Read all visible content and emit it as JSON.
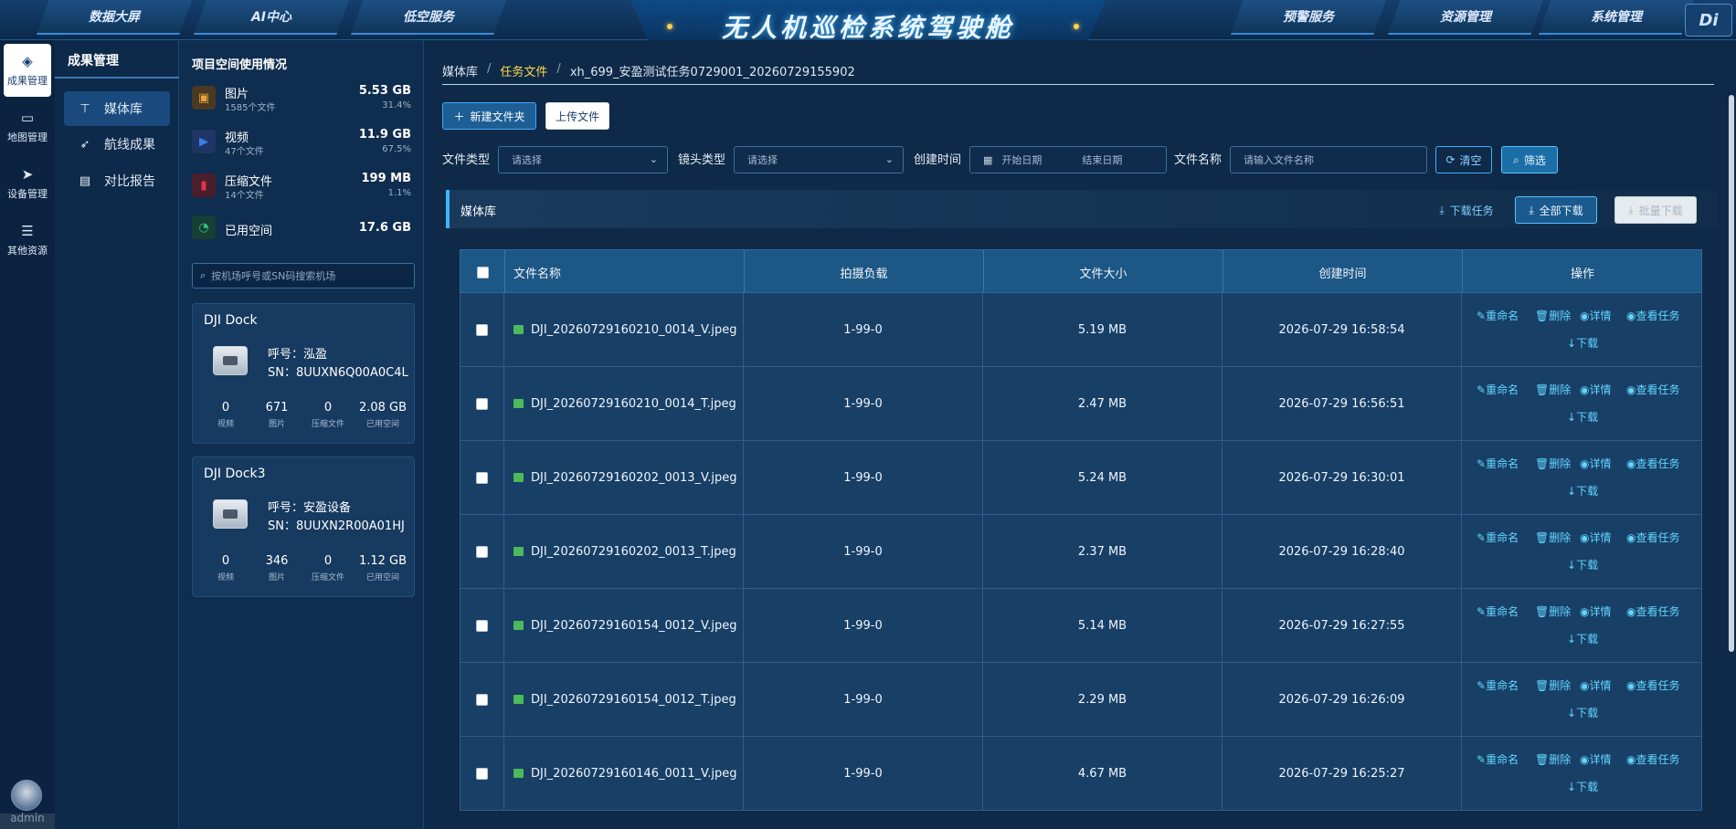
{
  "nav": {
    "left_tabs": [
      "数据大屏",
      "AI中心",
      "低空服务"
    ],
    "title": "无人机巡检系统驾驶舱",
    "right_tabs": [
      "预警服务",
      "资源管理",
      "系统管理"
    ],
    "logo": "Di"
  },
  "rail": {
    "items": [
      {
        "label": "成果管理",
        "icon": "layers-icon"
      },
      {
        "label": "地图管理",
        "icon": "monitor-icon"
      },
      {
        "label": "设备管理",
        "icon": "plane-icon"
      },
      {
        "label": "其他资源",
        "icon": "list-icon"
      }
    ],
    "user": "admin",
    "status_url": "https://172.88.3.108/home/result/media"
  },
  "submenu": {
    "title": "成果管理",
    "items": [
      {
        "label": "媒体库",
        "icon": "tree-icon"
      },
      {
        "label": "航线成果",
        "icon": "send-icon"
      },
      {
        "label": "对比报告",
        "icon": "doc-icon"
      }
    ]
  },
  "storage": {
    "title": "项目空间使用情况",
    "rows": [
      {
        "name": "图片",
        "sub": "1585个文件",
        "size": "5.53 GB",
        "pct": "31.4%",
        "icon": "image-icon",
        "color": "#e8a33b"
      },
      {
        "name": "视频",
        "sub": "47个文件",
        "size": "11.9 GB",
        "pct": "67.5%",
        "icon": "video-icon",
        "color": "#3b7be8"
      },
      {
        "name": "压缩文件",
        "sub": "14个文件",
        "size": "199 MB",
        "pct": "1.1%",
        "icon": "zip-icon",
        "color": "#e0344a"
      },
      {
        "name": "已用空间",
        "sub": "",
        "size": "17.6 GB",
        "pct": "",
        "icon": "pie-icon",
        "color": "#2ec27e"
      }
    ],
    "search_placeholder": "按机场呼号或SN码搜索机场"
  },
  "docks": [
    {
      "name": "DJI Dock",
      "call": "呼号：泓盈",
      "sn": "SN：8UUXN6Q00A0C4L",
      "stats": [
        {
          "v": "0",
          "l": "视频"
        },
        {
          "v": "671",
          "l": "图片"
        },
        {
          "v": "0",
          "l": "压缩文件"
        },
        {
          "v": "2.08 GB",
          "l": "已用空间"
        }
      ]
    },
    {
      "name": "DJI Dock3",
      "call": "呼号：安盈设备",
      "sn": "SN：8UUXN2R00A01HJ",
      "stats": [
        {
          "v": "0",
          "l": "视频"
        },
        {
          "v": "346",
          "l": "图片"
        },
        {
          "v": "0",
          "l": "压缩文件"
        },
        {
          "v": "1.12 GB",
          "l": "已用空间"
        }
      ]
    }
  ],
  "main": {
    "breadcrumb": [
      "媒体库",
      "任务文件",
      "xh_699_安盈测试任务0729001_20260729155902"
    ],
    "buttons": {
      "new_folder": "新建文件夹",
      "upload": "上传文件",
      "clear": "清空",
      "filter": "筛选"
    },
    "filters": {
      "file_type_label": "文件类型",
      "file_type_placeholder": "请选择",
      "lens_type_label": "镜头类型",
      "lens_type_placeholder": "请选择",
      "create_time_label": "创建时间",
      "start_date": "开始日期",
      "end_date": "结束日期",
      "file_name_label": "文件名称",
      "file_name_placeholder": "请输入文件名称"
    },
    "library": {
      "title": "媒体库",
      "download_task": "下载任务",
      "download_all": "全部下载",
      "batch_download": "批量下载"
    },
    "columns": [
      "文件名称",
      "拍摄负载",
      "文件大小",
      "创建时间",
      "操作"
    ],
    "actions": {
      "rename": "重命名",
      "delete": "删除",
      "detail": "详情",
      "view_task": "查看任务",
      "download": "下载"
    },
    "rows": [
      {
        "name": "DJI_20260729160210_0014_V.jpeg",
        "payload": "1-99-0",
        "size": "5.19 MB",
        "time": "2026-07-29 16:58:54"
      },
      {
        "name": "DJI_20260729160210_0014_T.jpeg",
        "payload": "1-99-0",
        "size": "2.47 MB",
        "time": "2026-07-29 16:56:51"
      },
      {
        "name": "DJI_20260729160202_0013_V.jpeg",
        "payload": "1-99-0",
        "size": "5.24 MB",
        "time": "2026-07-29 16:30:01"
      },
      {
        "name": "DJI_20260729160202_0013_T.jpeg",
        "payload": "1-99-0",
        "size": "2.37 MB",
        "time": "2026-07-29 16:28:40"
      },
      {
        "name": "DJI_20260729160154_0012_V.jpeg",
        "payload": "1-99-0",
        "size": "5.14 MB",
        "time": "2026-07-29 16:27:55"
      },
      {
        "name": "DJI_20260729160154_0012_T.jpeg",
        "payload": "1-99-0",
        "size": "2.29 MB",
        "time": "2026-07-29 16:26:09"
      },
      {
        "name": "DJI_20260729160146_0011_V.jpeg",
        "payload": "1-99-0",
        "size": "4.67 MB",
        "time": "2026-07-29 16:25:27"
      }
    ]
  }
}
